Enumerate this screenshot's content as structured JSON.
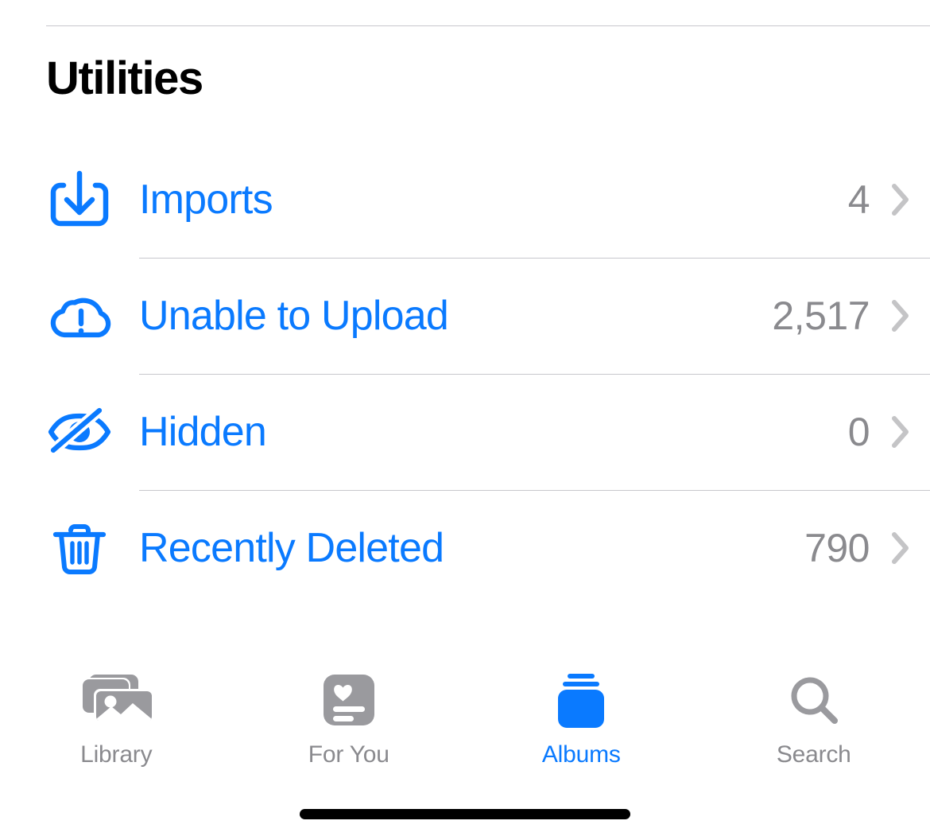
{
  "app": {
    "name": "Photos",
    "accent_color": "#0a7aff",
    "secondary_text_color": "#8a8a8e",
    "separator_color": "#c8c7cc",
    "background_color": "#ffffff"
  },
  "header": {
    "title": "Utilities"
  },
  "utilities": {
    "rows": [
      {
        "label": "Imports",
        "count": "4",
        "icon": "square-arrow-down-icon",
        "disclosure": "chevron-right-icon"
      },
      {
        "label": "Unable to Upload",
        "count": "2,517",
        "icon": "cloud-exclamation-icon",
        "disclosure": "chevron-right-icon"
      },
      {
        "label": "Hidden",
        "count": "0",
        "icon": "eye-slash-icon",
        "disclosure": "chevron-right-icon"
      },
      {
        "label": "Recently Deleted",
        "count": "790",
        "icon": "trash-icon",
        "disclosure": "chevron-right-icon"
      }
    ]
  },
  "tabbar": {
    "tabs": [
      {
        "label": "Library",
        "icon": "photo-stack-icon",
        "active": false
      },
      {
        "label": "For You",
        "icon": "heart-card-icon",
        "active": false
      },
      {
        "label": "Albums",
        "icon": "albums-stack-icon",
        "active": true
      },
      {
        "label": "Search",
        "icon": "magnifier-icon",
        "active": false
      }
    ]
  },
  "system": {
    "home_indicator": "home-indicator"
  }
}
